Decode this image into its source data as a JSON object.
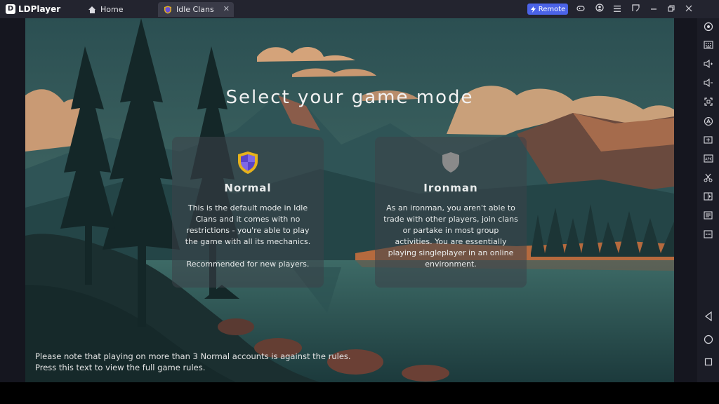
{
  "titlebar": {
    "app_name": "LDPlayer",
    "logo_letter": "D",
    "tabs": [
      {
        "label": "Home",
        "icon": "home-icon"
      },
      {
        "label": "Idle Clans",
        "icon": "game-shield-icon",
        "close": "✕"
      }
    ],
    "remote_label": "Remote",
    "controls": [
      "gamepad-icon",
      "account-icon",
      "menu-icon",
      "resize-icon",
      "minimize-icon",
      "restore-icon",
      "close-icon"
    ]
  },
  "game": {
    "title": "Select your game mode",
    "modes": [
      {
        "name": "Normal",
        "description": "This is the default mode in Idle Clans and it comes with no restrictions - you're able to play the game with all its mechanics.\n\nRecommended for new players.",
        "icon": "normal-shield-icon"
      },
      {
        "name": "Ironman",
        "description": "As an ironman, you aren't able to trade with other players, join clans or partake in most group activities. You are essentially playing singleplayer in an online environment.",
        "icon": "ironman-shield-icon"
      }
    ],
    "rules_note": "Please note that playing on more than 3 Normal accounts is against the rules.\nPress this text to view the full game rules."
  },
  "sidebar": {
    "icons": [
      "settings-icon",
      "keyboard-icon",
      "volume-up-icon",
      "volume-down-icon",
      "fullscreen-icon",
      "sync-icon",
      "add-app-icon",
      "apk-icon",
      "scissors-icon",
      "multi-instance-icon",
      "operation-record-icon",
      "more-icon",
      "back-icon",
      "home-circle-icon",
      "recent-apps-icon"
    ],
    "apk_label": "APK"
  },
  "colors": {
    "remote_button": "#4b63e8",
    "titlebar": "#23242f",
    "normal_shield_gold": "#e6b21c",
    "normal_shield_purple": "#5a44c9",
    "ironman_shield": "#8a8a8a"
  }
}
